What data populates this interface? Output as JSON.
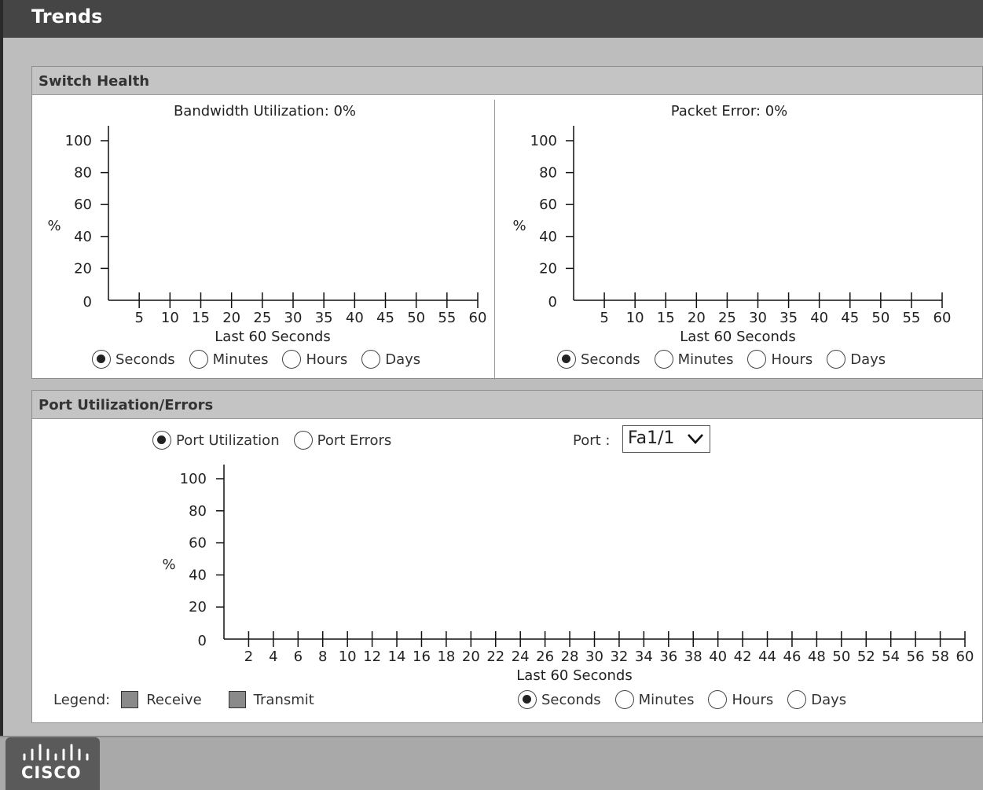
{
  "window": {
    "title": "Trends"
  },
  "switch_health": {
    "header": "Switch Health",
    "bandwidth": {
      "title": "Bandwidth Utilization: 0%",
      "ylabel": "%",
      "xlabel": "Last 60 Seconds",
      "range_options": [
        "Seconds",
        "Minutes",
        "Hours",
        "Days"
      ],
      "selected_range": "Seconds"
    },
    "packet_error": {
      "title": "Packet Error: 0%",
      "ylabel": "%",
      "xlabel": "Last 60 Seconds",
      "range_options": [
        "Seconds",
        "Minutes",
        "Hours",
        "Days"
      ],
      "selected_range": "Seconds"
    }
  },
  "port_panel": {
    "header": "Port Utilization/Errors",
    "mode_options": [
      "Port Utilization",
      "Port Errors"
    ],
    "selected_mode": "Port Utilization",
    "port_label": "Port :",
    "port_value": "Fa1/1",
    "ylabel": "%",
    "xlabel": "Last 60 Seconds",
    "range_options": [
      "Seconds",
      "Minutes",
      "Hours",
      "Days"
    ],
    "selected_range": "Seconds",
    "legend_label": "Legend:",
    "legend_items": [
      {
        "name": "Receive",
        "color": "#8a8a8a"
      },
      {
        "name": "Transmit",
        "color": "#8a8a8a"
      }
    ]
  },
  "logo": {
    "text": "CISCO"
  },
  "chart_data": [
    {
      "type": "line",
      "title": "Bandwidth Utilization: 0%",
      "xlabel": "Last 60 Seconds",
      "ylabel": "%",
      "xlim": [
        0,
        60
      ],
      "ylim": [
        0,
        100
      ],
      "x_ticks": [
        5,
        10,
        15,
        20,
        25,
        30,
        35,
        40,
        45,
        50,
        55,
        60
      ],
      "y_ticks": [
        0,
        20,
        40,
        60,
        80,
        100
      ],
      "series": []
    },
    {
      "type": "line",
      "title": "Packet Error: 0%",
      "xlabel": "Last 60 Seconds",
      "ylabel": "%",
      "xlim": [
        0,
        60
      ],
      "ylim": [
        0,
        100
      ],
      "x_ticks": [
        5,
        10,
        15,
        20,
        25,
        30,
        35,
        40,
        45,
        50,
        55,
        60
      ],
      "y_ticks": [
        0,
        20,
        40,
        60,
        80,
        100
      ],
      "series": []
    },
    {
      "type": "line",
      "title": "",
      "xlabel": "Last 60 Seconds",
      "ylabel": "%",
      "xlim": [
        0,
        60
      ],
      "ylim": [
        0,
        100
      ],
      "x_ticks": [
        2,
        4,
        6,
        8,
        10,
        12,
        14,
        16,
        18,
        20,
        22,
        24,
        26,
        28,
        30,
        32,
        34,
        36,
        38,
        40,
        42,
        44,
        46,
        48,
        50,
        52,
        54,
        56,
        58,
        60
      ],
      "y_ticks": [
        0,
        20,
        40,
        60,
        80,
        100
      ],
      "series": []
    }
  ]
}
